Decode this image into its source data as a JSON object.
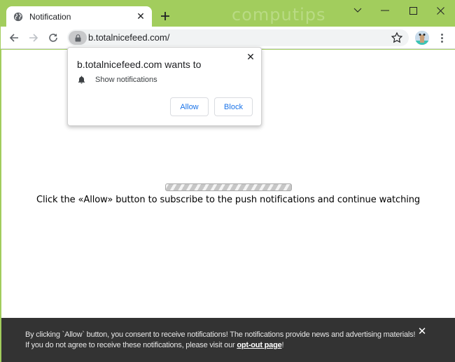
{
  "browser": {
    "tab": {
      "title": "Notification",
      "favicon": "globe-icon",
      "close_icon": "close-icon"
    },
    "new_tab_icon": "plus-icon",
    "watermark": "computips",
    "window_controls": [
      "chevron-down-icon",
      "minimize-icon",
      "maximize-icon",
      "close-icon"
    ],
    "nav": {
      "back": "back-arrow-icon",
      "forward": "forward-arrow-icon",
      "reload": "reload-icon"
    },
    "omnibox": {
      "url": "b.totalnicefeed.com/",
      "lock_icon": "lock-icon",
      "bookmark_icon": "star-icon"
    },
    "menu_icon": "kebab-menu-icon"
  },
  "popup": {
    "title": "b.totalnicefeed.com wants to",
    "permission": "Show notifications",
    "permission_icon": "bell-icon",
    "allow_label": "Allow",
    "block_label": "Block"
  },
  "page": {
    "headline": "Click the «Allow» button to subscribe to the push notifications and continue watching"
  },
  "banner": {
    "line1": "By clicking `Allow` button, you consent to receive notifications! The notifications provide news and advertising materials!",
    "line2_prefix": "If you do not agree to receive these notifications, please visit our ",
    "link_text": "opt-out page",
    "line2_suffix": "!"
  },
  "colors": {
    "frame": "#a2cd5d",
    "banner_bg": "#333333",
    "button_text": "#1a73e8"
  }
}
